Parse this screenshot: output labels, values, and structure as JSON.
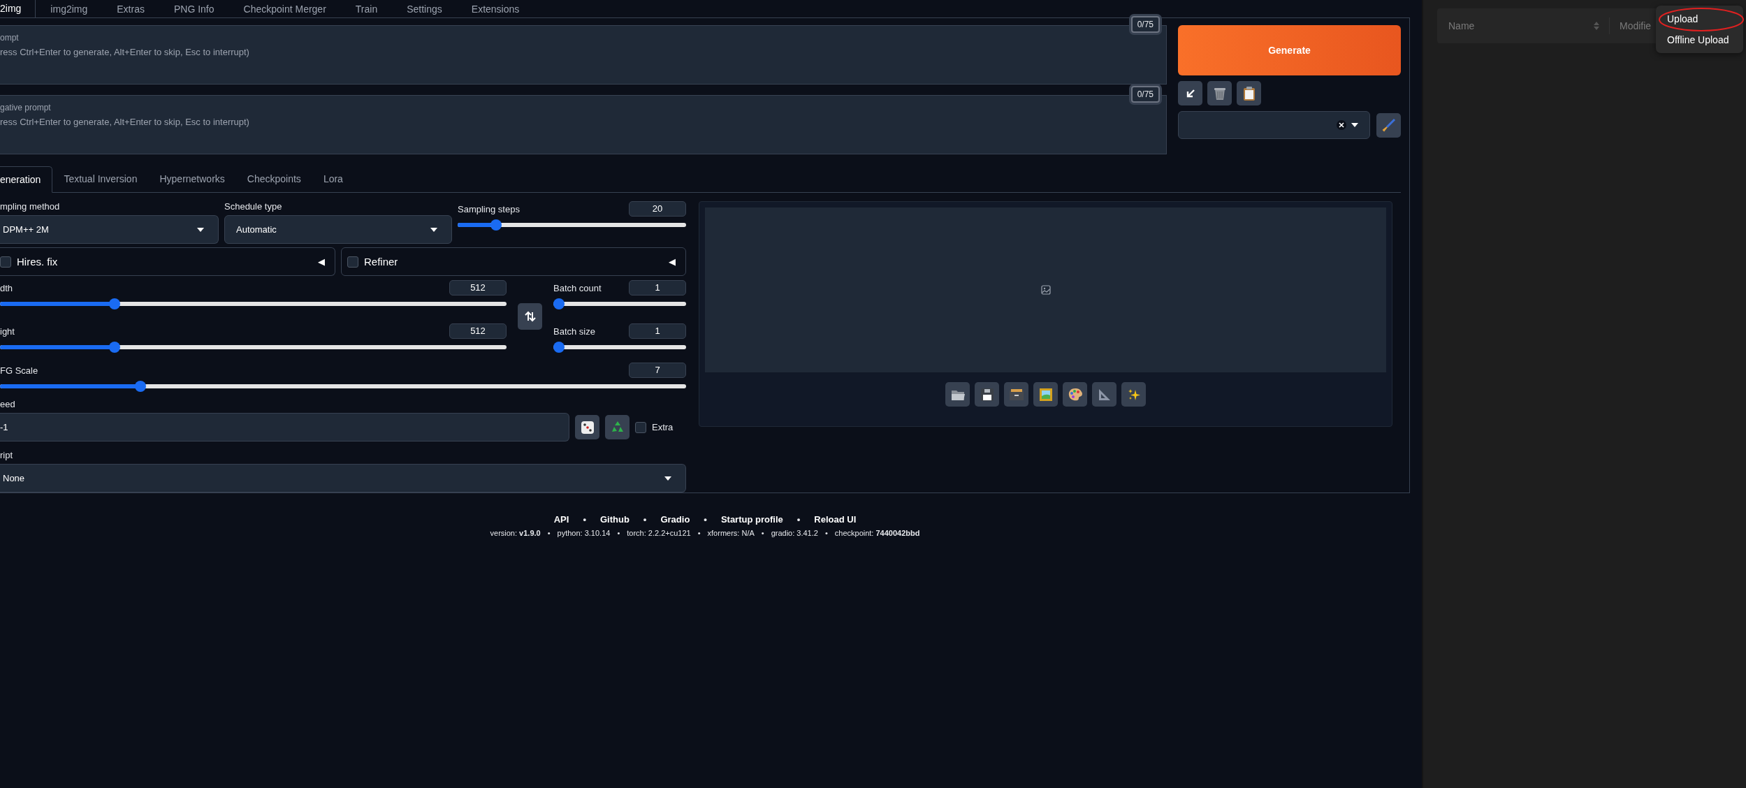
{
  "top_tabs": [
    {
      "label": "2img",
      "selected": true
    },
    {
      "label": "img2img",
      "selected": false
    },
    {
      "label": "Extras",
      "selected": false
    },
    {
      "label": "PNG Info",
      "selected": false
    },
    {
      "label": "Checkpoint Merger",
      "selected": false
    },
    {
      "label": "Train",
      "selected": false
    },
    {
      "label": "Settings",
      "selected": false
    },
    {
      "label": "Extensions",
      "selected": false
    }
  ],
  "prompt": {
    "label": "ompt",
    "placeholder": "ress Ctrl+Enter to generate, Alt+Enter to skip, Esc to interrupt)",
    "counter": "0/75"
  },
  "negative_prompt": {
    "label": "gative prompt",
    "placeholder": "ress Ctrl+Enter to generate, Alt+Enter to skip, Esc to interrupt)",
    "counter": "0/75"
  },
  "generate_button": "Generate",
  "sub_tabs": [
    {
      "label": "eneration",
      "selected": true
    },
    {
      "label": "Textual Inversion",
      "selected": false
    },
    {
      "label": "Hypernetworks",
      "selected": false
    },
    {
      "label": "Checkpoints",
      "selected": false
    },
    {
      "label": "Lora",
      "selected": false
    }
  ],
  "sampling_method": {
    "label": "mpling method",
    "value": "DPM++ 2M"
  },
  "schedule_type": {
    "label": "Schedule type",
    "value": "Automatic"
  },
  "sampling_steps": {
    "label": "Sampling steps",
    "value": "20",
    "level": 0.15
  },
  "hires_fix": {
    "label": "Hires. fix",
    "checked": false,
    "toggle": "◀"
  },
  "refiner": {
    "label": "Refiner",
    "checked": false,
    "toggle": "◀"
  },
  "width": {
    "label": "dth",
    "value": "512",
    "level": 0.22
  },
  "height": {
    "label": "ight",
    "value": "512",
    "level": 0.22
  },
  "batch_count": {
    "label": "Batch count",
    "value": "1",
    "level": 0
  },
  "batch_size": {
    "label": "Batch size",
    "value": "1",
    "level": 0
  },
  "cfg_scale": {
    "label": "FG Scale",
    "value": "7",
    "level": 0.2
  },
  "seed": {
    "label": "eed",
    "value": "-1"
  },
  "extra": {
    "label": "Extra",
    "checked": false
  },
  "script": {
    "label": "ript",
    "value": "None"
  },
  "footer": {
    "separator": "•",
    "links": [
      "API",
      "Github",
      "Gradio",
      "Startup profile",
      "Reload UI"
    ],
    "versions": [
      "version: **v1.9.0**",
      "python: 3.10.14",
      "torch: 2.2.2+cu121",
      "xformers: N/A",
      "gradio: 3.41.2",
      "checkpoint: **7440042bbd**"
    ]
  },
  "file_panel": {
    "columns": [
      "Name",
      "Modifie"
    ],
    "menu": [
      {
        "label": "Upload",
        "annotated": true
      },
      {
        "label": "Offline Upload",
        "annotated": false
      }
    ]
  }
}
